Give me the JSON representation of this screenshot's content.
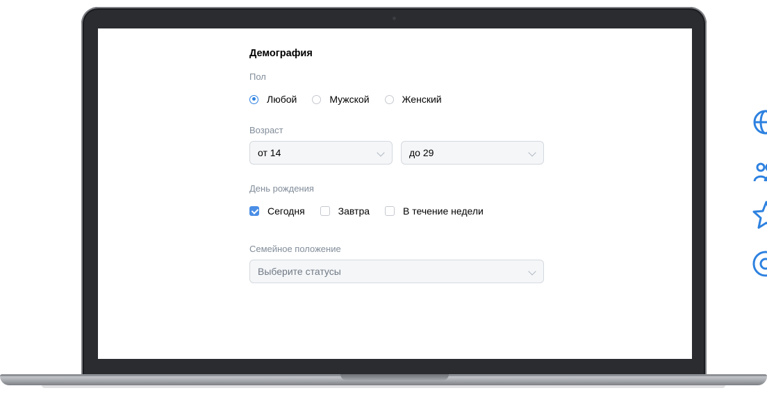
{
  "demographics": {
    "title": "Демография",
    "gender": {
      "label": "Пол",
      "options": [
        {
          "label": "Любой",
          "selected": true
        },
        {
          "label": "Мужской",
          "selected": false
        },
        {
          "label": "Женский",
          "selected": false
        }
      ]
    },
    "age": {
      "label": "Возраст",
      "from": "от 14",
      "to": "до 29"
    },
    "birthday": {
      "label": "День рождения",
      "options": [
        {
          "label": "Сегодня",
          "checked": true
        },
        {
          "label": "Завтра",
          "checked": false
        },
        {
          "label": "В течение недели",
          "checked": false
        }
      ]
    },
    "marital": {
      "label": "Семейное положение",
      "placeholder": "Выберите статусы"
    }
  },
  "side_icons": [
    "globe-icon",
    "users-icon",
    "star-icon",
    "at-icon"
  ],
  "colors": {
    "accent": "#2d81e0",
    "muted_label": "#818c99",
    "field_bg": "#f5f6f8"
  }
}
